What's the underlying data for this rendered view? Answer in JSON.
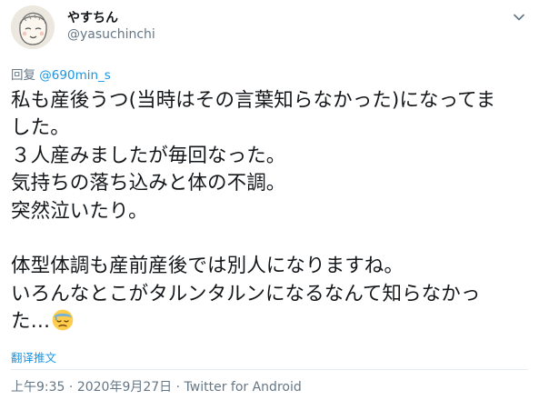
{
  "user": {
    "display_name": "やすちん",
    "handle": "@yasuchinchi",
    "avatar_icon": "hand-drawn-face-avatar"
  },
  "menu_icon": "chevron-down-icon",
  "reply": {
    "prefix": "回复 ",
    "mention": "@690min_s"
  },
  "tweet": {
    "lines": [
      "私も産後うつ(当時はその言葉知らなかった)になってま",
      "した。",
      "３人産みましたが毎回なった。",
      "気持ちの落ち込みと体の不調。",
      "突然泣いたり。",
      "",
      "体型体調も産前産後では別人になりますね。",
      "いろんなとこがタルンタルンになるなんて知らなかっ",
      "た…"
    ],
    "emoji_icon": "downcast-face-with-sweat-emoji"
  },
  "translate_label": "翻译推文",
  "meta": {
    "time": "上午9:35",
    "separator": " · ",
    "date": "2020年9月27日",
    "source": "Twitter for Android"
  },
  "colors": {
    "text": "#14171a",
    "secondary": "#657786",
    "link": "#1b95e0",
    "divider": "#e6ecf0"
  }
}
